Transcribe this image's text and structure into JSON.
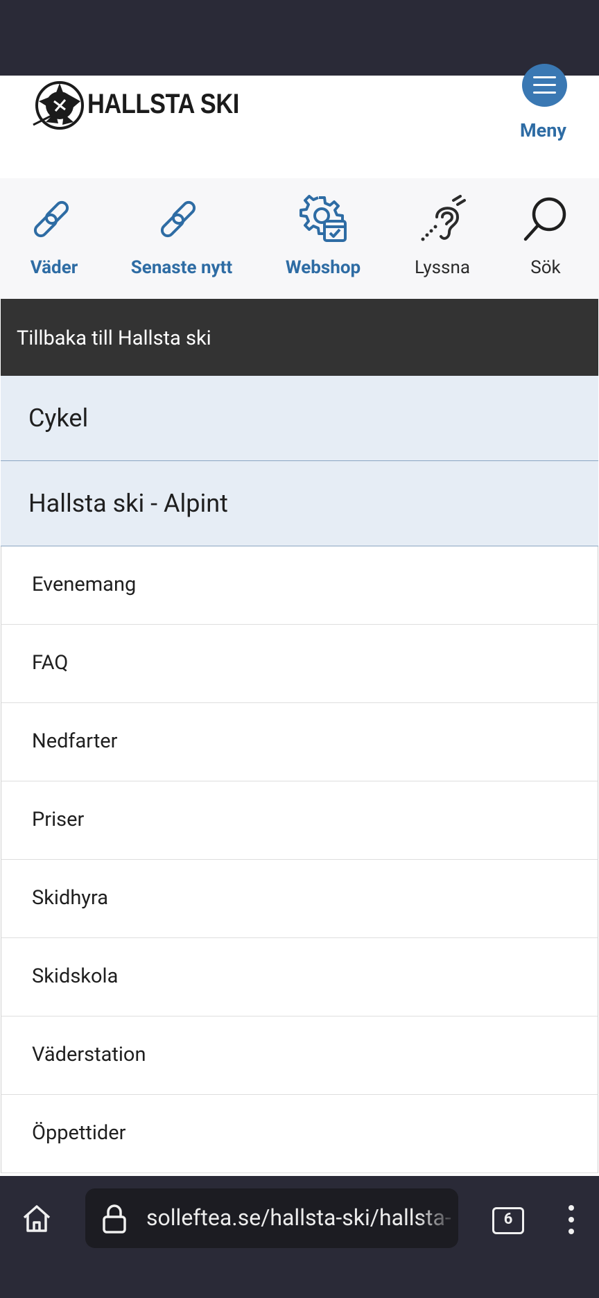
{
  "header": {
    "logo_text": "HALLSTA SKI",
    "menu_label": "Meny"
  },
  "quick_links": [
    {
      "label": "Väder",
      "icon": "link-icon"
    },
    {
      "label": "Senaste nytt",
      "icon": "link-icon"
    },
    {
      "label": "Webshop",
      "icon": "gear-calendar-icon"
    },
    {
      "label": "Lyssna",
      "icon": "ear-icon"
    },
    {
      "label": "Sök",
      "icon": "search-icon"
    }
  ],
  "navigation": {
    "back_label": "Tillbaka till Hallsta ski",
    "categories": [
      "Cykel",
      "Hallsta ski - Alpint"
    ],
    "items": [
      "Evenemang",
      "FAQ",
      "Nedfarter",
      "Priser",
      "Skidhyra",
      "Skidskola",
      "Väderstation",
      "Öppettider"
    ]
  },
  "browser": {
    "url": "solleftea.se/hallsta-ski/hallsta-",
    "tab_count": "6"
  },
  "colors": {
    "accent": "#2e6ca4",
    "menu_button": "#3a78b3",
    "back_bar": "#333333",
    "category_bg": "#e6edf5",
    "system_bar": "#2a2a37"
  }
}
